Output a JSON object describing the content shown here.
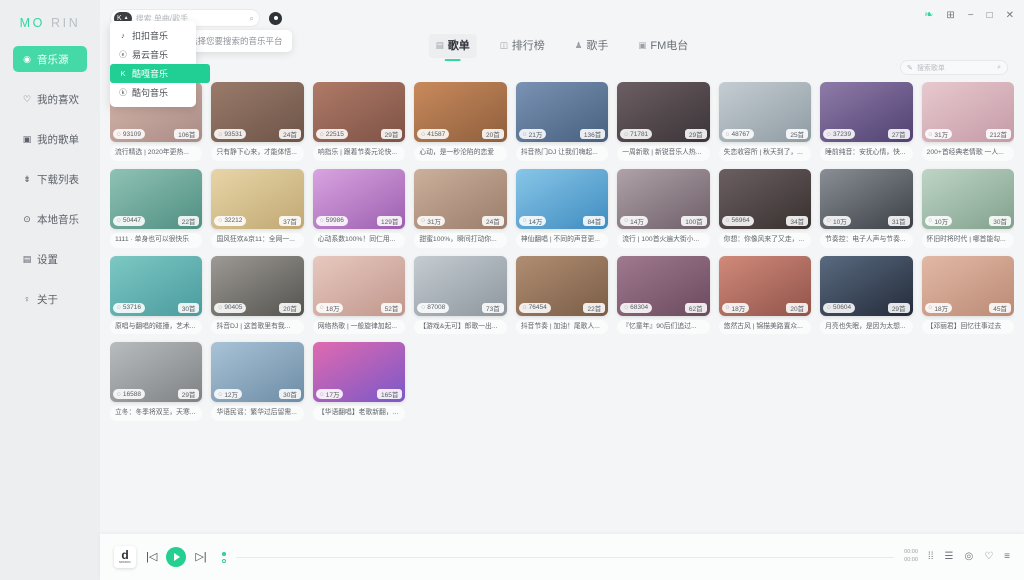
{
  "app": {
    "logo_primary": "MO",
    "logo_secondary": " RIN"
  },
  "sidebar": {
    "items": [
      {
        "icon": "◉",
        "label": "音乐源",
        "name": "music-source"
      },
      {
        "icon": "♡",
        "label": "我的喜欢",
        "name": "my-favorites"
      },
      {
        "icon": "▣",
        "label": "我的歌单",
        "name": "my-playlists"
      },
      {
        "icon": "⇟",
        "label": "下载列表",
        "name": "download-list"
      },
      {
        "icon": "⊙",
        "label": "本地音乐",
        "name": "local-music"
      },
      {
        "icon": "▤",
        "label": "设置",
        "name": "settings"
      },
      {
        "icon": "♀",
        "label": "关于",
        "name": "about"
      }
    ]
  },
  "search": {
    "platform_label": "K",
    "placeholder": "搜索 单曲/歌手",
    "value": "",
    "tooltip": "选择您要搜索的音乐平台"
  },
  "dropdown": {
    "items": [
      {
        "icon": "♪",
        "label": "扣扣音乐",
        "selected": false
      },
      {
        "icon": "ⓔ",
        "label": "易云音乐",
        "selected": false
      },
      {
        "icon": "K",
        "label": "酷嘎音乐",
        "selected": true
      },
      {
        "icon": "ⓚ",
        "label": "酷句音乐",
        "selected": false
      }
    ]
  },
  "tabs": [
    {
      "icon": "▤",
      "label": "歌单",
      "active": true
    },
    {
      "icon": "◫",
      "label": "排行榜",
      "active": false
    },
    {
      "icon": "♟",
      "label": "歌手",
      "active": false
    },
    {
      "icon": "▣",
      "label": "FM电台",
      "active": false
    }
  ],
  "window_controls": {
    "leaf": "❧",
    "pin": "⊞",
    "minimize": "−",
    "maximize": "□",
    "close": "✕"
  },
  "list_search": {
    "icon": "✎",
    "placeholder": "搜索歌单",
    "value": ""
  },
  "grid": {
    "cards": [
      {
        "plays": "93109",
        "count": "106首",
        "title": "流行精选 | 2020年更热...",
        "c1": "#d8b8ac",
        "c2": "#a98b86"
      },
      {
        "plays": "93531",
        "count": "24首",
        "title": "只有静下心来，才能体悟...",
        "c1": "#9a7b6a",
        "c2": "#6d5448"
      },
      {
        "plays": "22515",
        "count": "29首",
        "title": "响指乐 | 跟着节奏元论快...",
        "c1": "#b07a67",
        "c2": "#7d5246"
      },
      {
        "plays": "41587",
        "count": "20首",
        "title": "心动，是一秒沦陷的恋爱",
        "c1": "#c98a5c",
        "c2": "#8e5f3d"
      },
      {
        "plays": "21万",
        "count": "136首",
        "title": "抖音热门DJ 让我们嗨起...",
        "c1": "#7a93b4",
        "c2": "#47607f"
      },
      {
        "plays": "71781",
        "count": "29首",
        "title": "一周新歌 | 新锐音乐人热...",
        "c1": "#6c5f63",
        "c2": "#3b3438"
      },
      {
        "plays": "48767",
        "count": "25首",
        "title": "失恋收容所 | 秋天到了，...",
        "c1": "#c4cdd2",
        "c2": "#8f9ba3"
      },
      {
        "plays": "37239",
        "count": "27首",
        "title": "睡前纯音：安抚心情，快...",
        "c1": "#8f7ba8",
        "c2": "#4f4172"
      },
      {
        "plays": "31万",
        "count": "212首",
        "title": "200+首经典老情歌 一人...",
        "c1": "#e8c9cf",
        "c2": "#c49aa6"
      },
      {
        "plays": "50447",
        "count": "22首",
        "title": "1111 · 单身也可以很快乐",
        "c1": "#8fc2b4",
        "c2": "#4f8f82"
      },
      {
        "plays": "32212",
        "count": "37首",
        "title": "国风狂欢&京11：全网一...",
        "c1": "#e8d5a8",
        "c2": "#c0a872"
      },
      {
        "plays": "59986",
        "count": "129首",
        "title": "心动系数100%！同仁用...",
        "c1": "#d9a4e0",
        "c2": "#9c5fb0"
      },
      {
        "plays": "31万",
        "count": "24首",
        "title": "甜蜜100%，瞬间打动你...",
        "c1": "#cbb09c",
        "c2": "#9a7d6a"
      },
      {
        "plays": "14万",
        "count": "84首",
        "title": "神仙翻唱 | 不同的声音更...",
        "c1": "#88c6e8",
        "c2": "#3f8cc0"
      },
      {
        "plays": "14万",
        "count": "100首",
        "title": "流行 | 100首火遍大街小...",
        "c1": "#b0a2a8",
        "c2": "#6d5e68"
      },
      {
        "plays": "56964",
        "count": "34首",
        "title": "你想：你像风来了又走，...",
        "c1": "#6b5f62",
        "c2": "#38302f"
      },
      {
        "plays": "10万",
        "count": "31首",
        "title": "节奏控：电子人声与节奏...",
        "c1": "#8a8f96",
        "c2": "#3b3f46"
      },
      {
        "plays": "10万",
        "count": "30首",
        "title": "怀旧时将时代 | 哪首能勾...",
        "c1": "#bfd5c6",
        "c2": "#80a18c"
      },
      {
        "plays": "53716",
        "count": "30首",
        "title": "原唱与翻唱的碰撞，艺术...",
        "c1": "#7cc8c4",
        "c2": "#4b9b9e"
      },
      {
        "plays": "90405",
        "count": "20首",
        "title": "抖音DJ | 这首歌里有我...",
        "c1": "#9d9a95",
        "c2": "#55534f"
      },
      {
        "plays": "18万",
        "count": "52首",
        "title": "网络热歌 | 一般旋律加起...",
        "c1": "#e8c9bf",
        "c2": "#c0968c"
      },
      {
        "plays": "87008",
        "count": "73首",
        "title": "【游戏&无可】郎歌一出...",
        "c1": "#c5ccd2",
        "c2": "#8d969e"
      },
      {
        "plays": "76454",
        "count": "22首",
        "title": "抖音节奏 | 加油！尾歌人...",
        "c1": "#b08e72",
        "c2": "#7a5c46"
      },
      {
        "plays": "68304",
        "count": "62首",
        "title": "『忆童年』90后们追过...",
        "c1": "#a07a8e",
        "c2": "#6b4a5e"
      },
      {
        "plays": "18万",
        "count": "20首",
        "title": "悠然古风 | 锦描美路置众...",
        "c1": "#d08a7a",
        "c2": "#91534a"
      },
      {
        "plays": "50604",
        "count": "29首",
        "title": "月亮也失眠，是因为太想...",
        "c1": "#5a6a80",
        "c2": "#232b3a"
      },
      {
        "plays": "18万",
        "count": "45首",
        "title": "【邓丽君】回忆往事过去",
        "c1": "#e2b9a6",
        "c2": "#bb8a74"
      },
      {
        "plays": "16588",
        "count": "29首",
        "title": "立冬：冬季将双至，天寒...",
        "c1": "#b8bcbe",
        "c2": "#7e8285"
      },
      {
        "plays": "12万",
        "count": "30首",
        "title": "华语民谣：繁华过后留需...",
        "c1": "#a9c3d6",
        "c2": "#6d8ca6"
      },
      {
        "plays": "17万",
        "count": "165首",
        "title": "【华语翻唱】老歌新翻，...",
        "c1": "#e06ab0",
        "c2": "#7a58c8"
      }
    ]
  },
  "player": {
    "album_title": "d",
    "album_sub": "MORIN",
    "prev": "|◁",
    "play": "▶",
    "next": "▷|",
    "time_current": "00:00",
    "time_total": "00:00",
    "icons": {
      "equalizer": "⁞⁞",
      "lyrics": "☰",
      "repeat": "◎",
      "favorite": "♡",
      "queue": "≡"
    }
  }
}
